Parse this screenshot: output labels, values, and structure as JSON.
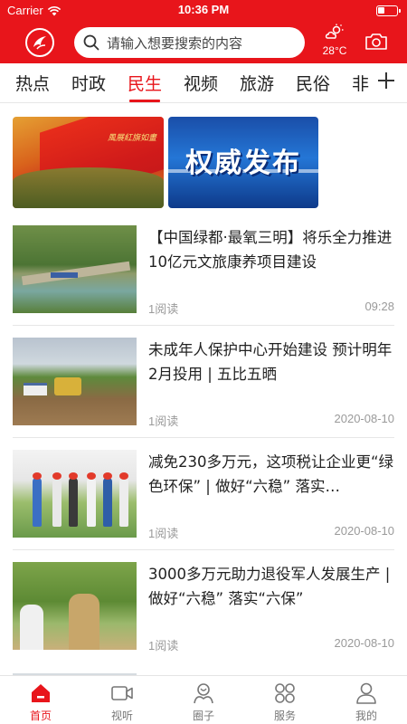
{
  "status_bar": {
    "carrier": "Carrier",
    "time": "10:36 PM"
  },
  "header": {
    "search_placeholder": "请输入想要搜索的内容",
    "weather_temp": "28°C",
    "brand_color": "#e8151b"
  },
  "tabs": [
    {
      "label": "热点"
    },
    {
      "label": "时政"
    },
    {
      "label": "民生",
      "active": true
    },
    {
      "label": "视频"
    },
    {
      "label": "旅游"
    },
    {
      "label": "民俗"
    },
    {
      "label": "非"
    }
  ],
  "banners": {
    "left_caption": "風展紅旗如畫",
    "right_text": "权威发布"
  },
  "news": [
    {
      "title": "【中国绿都·最氧三明】将乐全力推进10亿元文旅康养项目建设",
      "reads": "1阅读",
      "date": "09:28"
    },
    {
      "title": "未成年人保护中心开始建设 预计明年2月投用 | 五比五晒",
      "reads": "1阅读",
      "date": "2020-08-10"
    },
    {
      "title": "减免230多万元，这项税让企业更“绿色环保” | 做好“六稳” 落实…",
      "reads": "1阅读",
      "date": "2020-08-10"
    },
    {
      "title": "3000多万元助力退役军人发展生产 | 做好“六稳” 落实“六保”",
      "reads": "1阅读",
      "date": "2020-08-10"
    }
  ],
  "bottom_nav": [
    {
      "label": "首页",
      "active": true
    },
    {
      "label": "视听"
    },
    {
      "label": "圈子"
    },
    {
      "label": "服务"
    },
    {
      "label": "我的"
    }
  ]
}
